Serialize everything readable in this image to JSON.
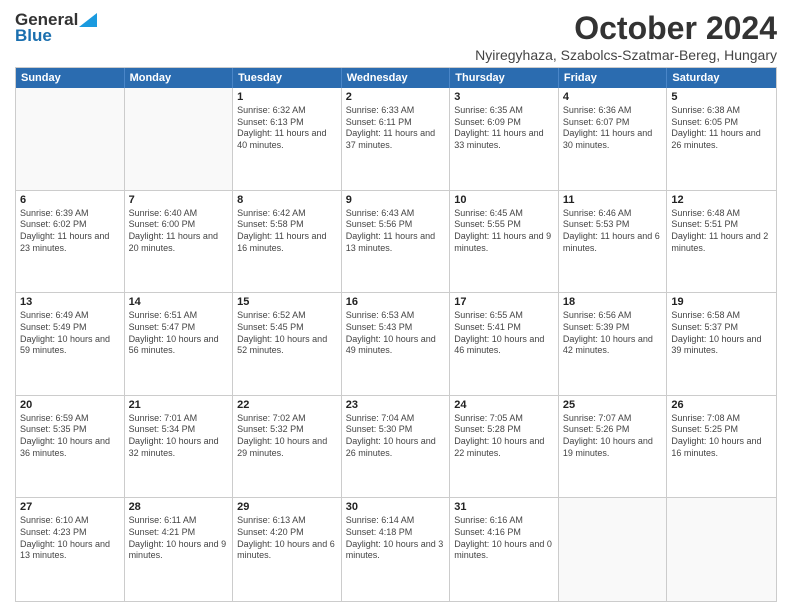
{
  "logo": {
    "general": "General",
    "blue": "Blue"
  },
  "title": "October 2024",
  "location": "Nyiregyhaza, Szabolcs-Szatmar-Bereg, Hungary",
  "weekdays": [
    "Sunday",
    "Monday",
    "Tuesday",
    "Wednesday",
    "Thursday",
    "Friday",
    "Saturday"
  ],
  "weeks": [
    [
      {
        "day": "",
        "empty": true
      },
      {
        "day": "",
        "empty": true
      },
      {
        "day": "1",
        "sunrise": "6:32 AM",
        "sunset": "6:13 PM",
        "daylight": "11 hours and 40 minutes."
      },
      {
        "day": "2",
        "sunrise": "6:33 AM",
        "sunset": "6:11 PM",
        "daylight": "11 hours and 37 minutes."
      },
      {
        "day": "3",
        "sunrise": "6:35 AM",
        "sunset": "6:09 PM",
        "daylight": "11 hours and 33 minutes."
      },
      {
        "day": "4",
        "sunrise": "6:36 AM",
        "sunset": "6:07 PM",
        "daylight": "11 hours and 30 minutes."
      },
      {
        "day": "5",
        "sunrise": "6:38 AM",
        "sunset": "6:05 PM",
        "daylight": "11 hours and 26 minutes."
      }
    ],
    [
      {
        "day": "6",
        "sunrise": "6:39 AM",
        "sunset": "6:02 PM",
        "daylight": "11 hours and 23 minutes."
      },
      {
        "day": "7",
        "sunrise": "6:40 AM",
        "sunset": "6:00 PM",
        "daylight": "11 hours and 20 minutes."
      },
      {
        "day": "8",
        "sunrise": "6:42 AM",
        "sunset": "5:58 PM",
        "daylight": "11 hours and 16 minutes."
      },
      {
        "day": "9",
        "sunrise": "6:43 AM",
        "sunset": "5:56 PM",
        "daylight": "11 hours and 13 minutes."
      },
      {
        "day": "10",
        "sunrise": "6:45 AM",
        "sunset": "5:55 PM",
        "daylight": "11 hours and 9 minutes."
      },
      {
        "day": "11",
        "sunrise": "6:46 AM",
        "sunset": "5:53 PM",
        "daylight": "11 hours and 6 minutes."
      },
      {
        "day": "12",
        "sunrise": "6:48 AM",
        "sunset": "5:51 PM",
        "daylight": "11 hours and 2 minutes."
      }
    ],
    [
      {
        "day": "13",
        "sunrise": "6:49 AM",
        "sunset": "5:49 PM",
        "daylight": "10 hours and 59 minutes."
      },
      {
        "day": "14",
        "sunrise": "6:51 AM",
        "sunset": "5:47 PM",
        "daylight": "10 hours and 56 minutes."
      },
      {
        "day": "15",
        "sunrise": "6:52 AM",
        "sunset": "5:45 PM",
        "daylight": "10 hours and 52 minutes."
      },
      {
        "day": "16",
        "sunrise": "6:53 AM",
        "sunset": "5:43 PM",
        "daylight": "10 hours and 49 minutes."
      },
      {
        "day": "17",
        "sunrise": "6:55 AM",
        "sunset": "5:41 PM",
        "daylight": "10 hours and 46 minutes."
      },
      {
        "day": "18",
        "sunrise": "6:56 AM",
        "sunset": "5:39 PM",
        "daylight": "10 hours and 42 minutes."
      },
      {
        "day": "19",
        "sunrise": "6:58 AM",
        "sunset": "5:37 PM",
        "daylight": "10 hours and 39 minutes."
      }
    ],
    [
      {
        "day": "20",
        "sunrise": "6:59 AM",
        "sunset": "5:35 PM",
        "daylight": "10 hours and 36 minutes."
      },
      {
        "day": "21",
        "sunrise": "7:01 AM",
        "sunset": "5:34 PM",
        "daylight": "10 hours and 32 minutes."
      },
      {
        "day": "22",
        "sunrise": "7:02 AM",
        "sunset": "5:32 PM",
        "daylight": "10 hours and 29 minutes."
      },
      {
        "day": "23",
        "sunrise": "7:04 AM",
        "sunset": "5:30 PM",
        "daylight": "10 hours and 26 minutes."
      },
      {
        "day": "24",
        "sunrise": "7:05 AM",
        "sunset": "5:28 PM",
        "daylight": "10 hours and 22 minutes."
      },
      {
        "day": "25",
        "sunrise": "7:07 AM",
        "sunset": "5:26 PM",
        "daylight": "10 hours and 19 minutes."
      },
      {
        "day": "26",
        "sunrise": "7:08 AM",
        "sunset": "5:25 PM",
        "daylight": "10 hours and 16 minutes."
      }
    ],
    [
      {
        "day": "27",
        "sunrise": "6:10 AM",
        "sunset": "4:23 PM",
        "daylight": "10 hours and 13 minutes."
      },
      {
        "day": "28",
        "sunrise": "6:11 AM",
        "sunset": "4:21 PM",
        "daylight": "10 hours and 9 minutes."
      },
      {
        "day": "29",
        "sunrise": "6:13 AM",
        "sunset": "4:20 PM",
        "daylight": "10 hours and 6 minutes."
      },
      {
        "day": "30",
        "sunrise": "6:14 AM",
        "sunset": "4:18 PM",
        "daylight": "10 hours and 3 minutes."
      },
      {
        "day": "31",
        "sunrise": "6:16 AM",
        "sunset": "4:16 PM",
        "daylight": "10 hours and 0 minutes."
      },
      {
        "day": "",
        "empty": true
      },
      {
        "day": "",
        "empty": true
      }
    ]
  ]
}
